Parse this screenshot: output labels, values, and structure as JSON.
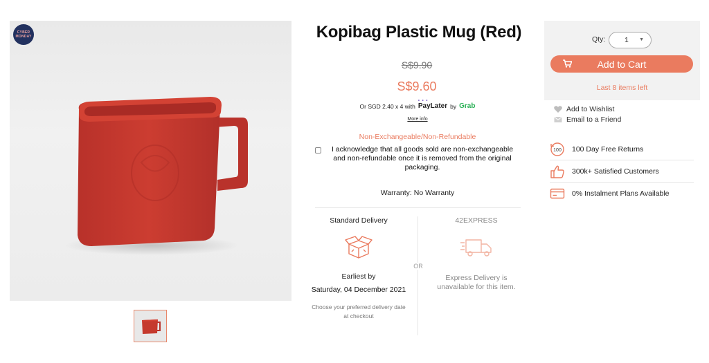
{
  "badge": {
    "line1": "CYBER",
    "line2": "MONDAY"
  },
  "product": {
    "title": "Kopibag Plastic Mug (Red)",
    "old_price": "S$9.90",
    "price": "S$9.60",
    "paylater_prefix": "Or SGD 2.40 x 4 with",
    "paylater_brand": "PayLater",
    "paylater_by": "by",
    "paylater_grab": "Grab",
    "more_info": "More info",
    "policy": "Non-Exchangeable/Non-Refundable",
    "acknowledge": "I acknowledge that all goods sold are non-exchangeable and non-refundable once it is removed from the original packaging.",
    "warranty": "Warranty: No Warranty"
  },
  "delivery": {
    "standard_title": "Standard Delivery",
    "earliest_label": "Earliest by",
    "earliest_date": "Saturday, 04 December 2021",
    "choose_note": "Choose your preferred delivery date at checkout",
    "or": "OR",
    "express_title": "42EXPRESS",
    "express_note": "Express Delivery is unavailable for this item."
  },
  "cart": {
    "qty_label": "Qty:",
    "qty_value": "1",
    "add_to_cart": "Add to Cart",
    "stock_note": "Last 8 items left"
  },
  "links": {
    "wishlist": "Add to Wishlist",
    "email": "Email to a Friend"
  },
  "perks": [
    {
      "label": "100 Day Free Returns",
      "icon": "returns-100-icon"
    },
    {
      "label": "300k+ Satisfied Customers",
      "icon": "thumbs-up-icon"
    },
    {
      "label": "0% Instalment Plans Available",
      "icon": "credit-card-icon"
    }
  ],
  "colors": {
    "accent": "#ea7b5f",
    "mug": "#c53a2e",
    "panel": "#f2f2f2",
    "badge": "#22315f",
    "grab": "#2fb25a"
  }
}
